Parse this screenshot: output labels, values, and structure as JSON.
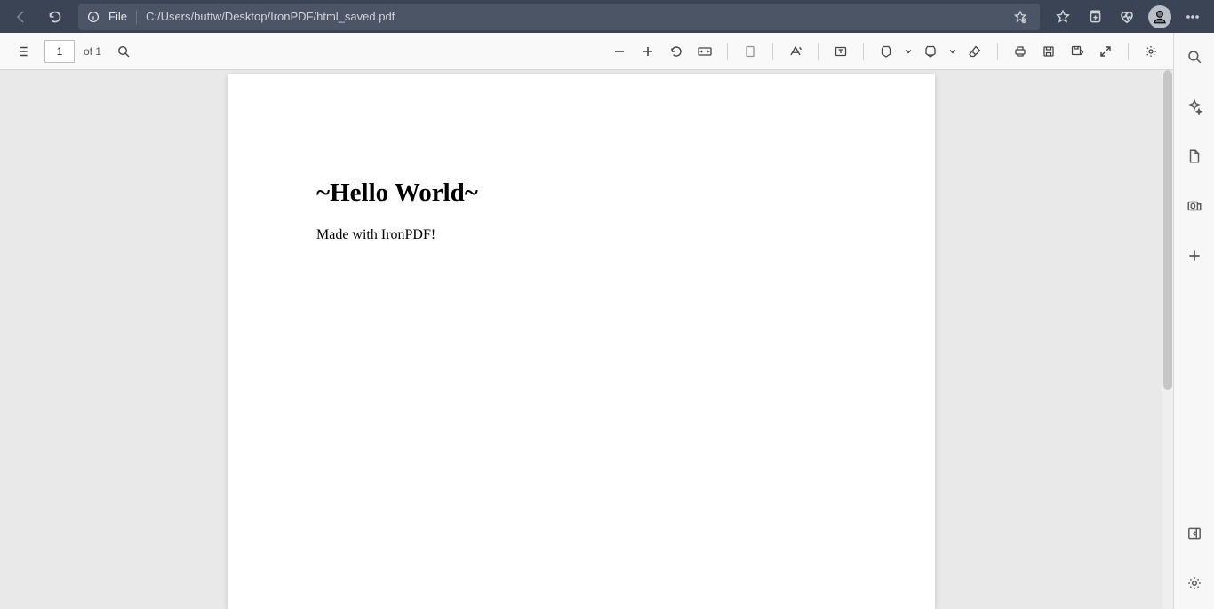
{
  "browser": {
    "file_label": "File",
    "path": "C:/Users/buttw/Desktop/IronPDF/html_saved.pdf",
    "icons": {
      "back": "back-icon",
      "refresh": "refresh-icon",
      "info": "info-icon",
      "add_favorite": "add-favorite-icon",
      "favorites": "favorites-star-icon",
      "collections": "collections-icon",
      "health": "heartbeat-icon",
      "profile": "profile-avatar",
      "more": "more-icon"
    }
  },
  "pdf_toolbar": {
    "page_current": "1",
    "page_of_label": "of 1",
    "icons": {
      "contents": "contents-icon",
      "find": "find-icon",
      "zoom_out": "zoom-out-icon",
      "zoom_in": "zoom-in-icon",
      "rotate": "rotate-icon",
      "fit_width": "fit-width-icon",
      "page_view": "page-view-icon",
      "read_aloud": "read-aloud-icon",
      "add_text": "add-text-icon",
      "draw": "draw-icon",
      "highlight": "highlight-icon",
      "erase": "erase-icon",
      "print": "print-icon",
      "save": "save-icon",
      "save_as": "save-as-icon",
      "full_screen": "full-screen-icon",
      "settings": "settings-icon"
    }
  },
  "document": {
    "heading": "~Hello World~",
    "body": "Made with IronPDF!"
  },
  "right_sidebar": {
    "icons": {
      "search": "search-icon",
      "copilot": "sparkle-icon",
      "doc": "doc-icon",
      "outlook": "outlook-icon",
      "add": "plus-icon",
      "panel": "panel-icon",
      "settings": "gear-icon"
    }
  },
  "colors": {
    "browser_bg": "#3b4455",
    "address_bg": "#4b5565",
    "viewport_bg": "#e9e9e9"
  }
}
